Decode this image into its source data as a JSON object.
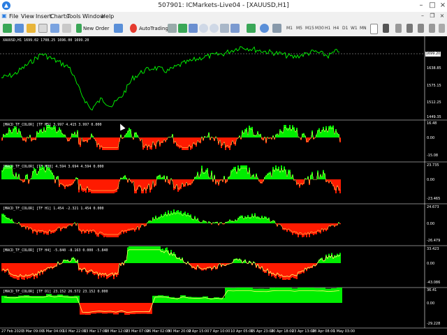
{
  "window": {
    "title": "507901: ICMarkets-Live04 - [XAUUSD,H1]",
    "icon": "metatrader-icon",
    "controls": [
      "minimize-icon",
      "maximize-icon",
      "close-icon"
    ]
  },
  "menu": [
    "File",
    "View",
    "Insert",
    "Charts",
    "Tools",
    "Window",
    "Help"
  ],
  "toolbar": {
    "new_order_label": "New Order",
    "autotrading_label": "AutoTrading",
    "timeframes": [
      "M1",
      "M5",
      "M15",
      "M30",
      "H1",
      "H4",
      "D1",
      "W1",
      "MN"
    ],
    "icons": [
      "new-chart-icon",
      "profiles-icon",
      "market-watch-icon",
      "navigator-icon",
      "terminal-icon",
      "tester-icon",
      "new-order-icon",
      "metaeditor-icon",
      "autotrading-icon",
      "bar-chart-icon",
      "candles-icon",
      "line-chart-icon",
      "zoom-in-icon",
      "zoom-out-icon",
      "tile-icon",
      "autoscroll-icon",
      "chart-shift-icon",
      "indicators-icon",
      "periods-icon",
      "templates-icon",
      "crosshair-cursor-icon",
      "line-tool-icon",
      "text-tool-icon"
    ]
  },
  "colors": {
    "price_line": "#00ff00",
    "hist_positive": "#00ee00",
    "hist_negative": "#ff1a00",
    "signal_line": "#ffff66",
    "background": "#000000",
    "grid": "#ffffff"
  },
  "main_chart": {
    "label": "XAUUSD,H1  1699.02 1708.25 1696.00 1699.20",
    "current_price": "1699.20",
    "y_ticks": [
      "1699.20",
      "1638.85",
      "1575.15",
      "1512.25",
      "1449.35"
    ]
  },
  "indicator_panels": [
    {
      "label": "[MACD_TF_COLOR] [TF M5] 3.997 4.415 3.997 0.000",
      "y_ticks": [
        "16.48",
        "0.00",
        "-15.08"
      ]
    },
    {
      "label": "[MACD_TF_COLOR] [TF M30] 4.594 3.694 4.594 0.000",
      "y_ticks": [
        "23.735",
        "0.00",
        "-23.465"
      ]
    },
    {
      "label": "[MACD_TF_COLOR] [TF H1] 1.454 -2.321 1.454 0.000",
      "y_ticks": [
        "24.673",
        "0.00",
        "-26.479"
      ]
    },
    {
      "label": "[MACD_TF_COLOR] [TF H4] -5.840 -8.163 0.000 -5.840",
      "y_ticks": [
        "33.423",
        "0.00",
        "-43.086"
      ]
    },
    {
      "label": "[MACD_TF_COLOR] [TF D1] 23.152 26.572 23.152 0.000",
      "y_ticks": [
        "36.41",
        "0.00",
        "-29.228"
      ]
    }
  ],
  "x_axis": [
    "27 Feb 2020",
    "3 Mar 09:00",
    "6 Mar 04:00",
    "10 Mar 22:00",
    "13 Mar 17:00",
    "18 Mar 12:00",
    "23 Mar 07:00",
    "26 Mar 02:00",
    "30 Mar 20:00",
    "2 Apr 15:00",
    "7 Apr 10:00",
    "10 Apr 05:00",
    "15 Apr 23:00",
    "20 Apr 18:00",
    "23 Apr 13:00",
    "28 Apr 08:00",
    "1 May 03:00"
  ]
}
